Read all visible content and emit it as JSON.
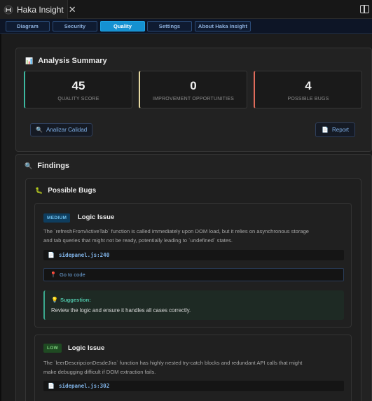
{
  "window": {
    "tab_title": "Haka Insight",
    "close_glyph": "✕"
  },
  "nav": {
    "tabs": [
      {
        "label": "Diagram"
      },
      {
        "label": "Security"
      },
      {
        "label": "Quality"
      },
      {
        "label": "Settings"
      },
      {
        "label": "About Haka Insight"
      }
    ],
    "active": "Quality"
  },
  "summary": {
    "title": "Analysis Summary",
    "icon": "📊",
    "stats": [
      {
        "value": "45",
        "label": "QUALITY SCORE",
        "accent": "#3db9a0"
      },
      {
        "value": "0",
        "label": "IMPROVEMENT OPPORTUNITIES",
        "accent": "#e6d9a2"
      },
      {
        "value": "4",
        "label": "POSSIBLE BUGS",
        "accent": "#e06b5b"
      }
    ],
    "analyze_button": "Analizar Calidad",
    "analyze_icon": "🔍",
    "report_button": "Report",
    "report_icon": "📄"
  },
  "findings": {
    "title": "Findings",
    "icon": "🔍",
    "bugs_title": "Possible Bugs",
    "bugs_icon": "🐛",
    "items": [
      {
        "severity": "MEDIUM",
        "title": "Logic Issue",
        "description_lines": [
          "The `refreshFromActiveTab` function is called immediately upon DOM load, but it relies on asynchronous storage",
          "and tab queries that might not be ready, potentially leading to `undefined` states."
        ],
        "file": "sidepanel.js:240",
        "goto_label": "Go to code",
        "suggestion_head": "Suggestion:",
        "suggestion_body": "Review the logic and ensure it handles all cases correctly."
      },
      {
        "severity": "LOW",
        "title": "Logic Issue",
        "description_lines": [
          "The `leerDescripcionDesdeJira` function has highly nested try-catch blocks and redundant API calls that might",
          "make debugging difficult if DOM extraction fails."
        ],
        "file": "sidepanel.js:302"
      }
    ]
  },
  "colors": {
    "nav_active": "#1591d1",
    "link": "#7fb0e8",
    "suggestion_accent": "#3aa88c"
  }
}
